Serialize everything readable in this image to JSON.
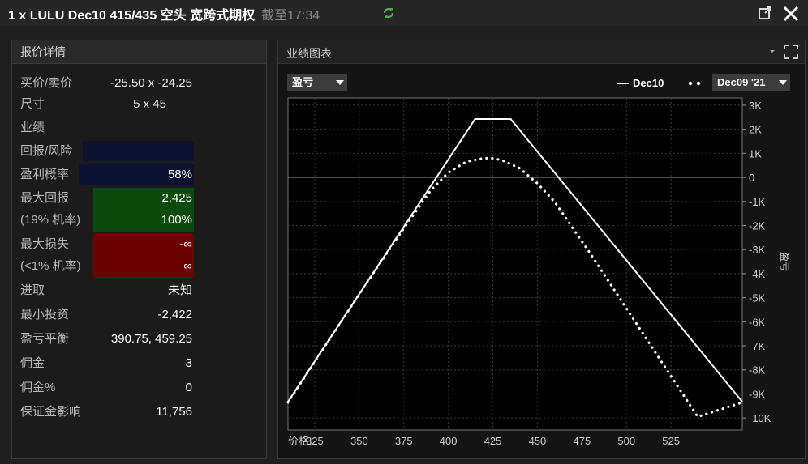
{
  "window": {
    "title": "1 x LULU Dec10 415/435 空头 宽跨式期权",
    "subtitle": "截至17:34"
  },
  "quote_panel": {
    "header": "报价详情",
    "bid_ask_label": "买价/卖价",
    "bid_ask_value": "-25.50 x -24.25",
    "size_label": "尺寸",
    "size_value": "5 x 45",
    "performance_label": "业绩",
    "return_risk_label": "回报/风险",
    "return_risk_value": "",
    "profit_prob_label": "盈利概率",
    "profit_prob_value": "58%",
    "max_return_label": "最大回报",
    "max_return_value": "2,425",
    "max_return_prob_label": "(19% 机率)",
    "max_return_pct": "100%",
    "max_loss_label": "最大损失",
    "max_loss_value": "-∞",
    "max_loss_prob_label": "(<1% 机率)",
    "max_loss_pct": "∞",
    "aggressive_label": "进取",
    "aggressive_value": "未知",
    "min_invest_label": "最小投资",
    "min_invest_value": "-2,422",
    "breakeven_label": "盈亏平衡",
    "breakeven_value": "390.75, 459.25",
    "commission_label": "佣金",
    "commission_value": "3",
    "commission_pct_label": "佣金%",
    "commission_pct_value": "0",
    "margin_label": "保证金影响",
    "margin_value": "11,756"
  },
  "chart_panel": {
    "header": "业绩图表",
    "metric_select": "盈亏",
    "date_select": "Dec09 '21",
    "price_label": "价格:",
    "y_axis_label": "盈亏"
  },
  "colors": {
    "bg": "#1e1e1e",
    "return_risk_bar": "#0c1230",
    "max_return_bar": "#0a4a0a",
    "max_loss_bar": "#6b0000"
  },
  "icons": [
    "refresh-icon",
    "popout-icon",
    "close-icon",
    "expand-icon",
    "chevron-down-icon"
  ],
  "chart_data": {
    "type": "line",
    "xlim": [
      310,
      565
    ],
    "ylim": [
      -10500,
      3300
    ],
    "x_ticks": [
      325,
      350,
      375,
      400,
      425,
      450,
      475,
      500,
      525
    ],
    "y_ticks": [
      {
        "v": 3000,
        "label": "3K"
      },
      {
        "v": 2000,
        "label": "2K"
      },
      {
        "v": 1000,
        "label": "1K"
      },
      {
        "v": 0,
        "label": "0"
      },
      {
        "v": -1000,
        "label": "-1K"
      },
      {
        "v": -2000,
        "label": "-2K"
      },
      {
        "v": -3000,
        "label": "-3K"
      },
      {
        "v": -4000,
        "label": "-4K"
      },
      {
        "v": -5000,
        "label": "-5K"
      },
      {
        "v": -6000,
        "label": "-6K"
      },
      {
        "v": -7000,
        "label": "-7K"
      },
      {
        "v": -8000,
        "label": "-8K"
      },
      {
        "v": -9000,
        "label": "-9K"
      },
      {
        "v": -10000,
        "label": "-10K"
      }
    ],
    "grid": true,
    "series": [
      {
        "name": "Dec10",
        "style": "solid",
        "x": [
          310,
          415,
          435,
          565
        ],
        "y": [
          -9325,
          2425,
          2425,
          -9325
        ]
      },
      {
        "name": "Dec09 '21",
        "style": "dotted",
        "x": [
          310,
          330,
          350,
          370,
          390,
          400,
          410,
          420,
          425,
          430,
          440,
          450,
          460,
          480,
          500,
          520,
          540,
          565
        ],
        "y": [
          -9350,
          -7100,
          -4850,
          -2650,
          -550,
          200,
          650,
          800,
          790,
          720,
          380,
          -250,
          -1050,
          -3200,
          -5450,
          -7700,
          -9950,
          -9350
        ]
      }
    ]
  }
}
